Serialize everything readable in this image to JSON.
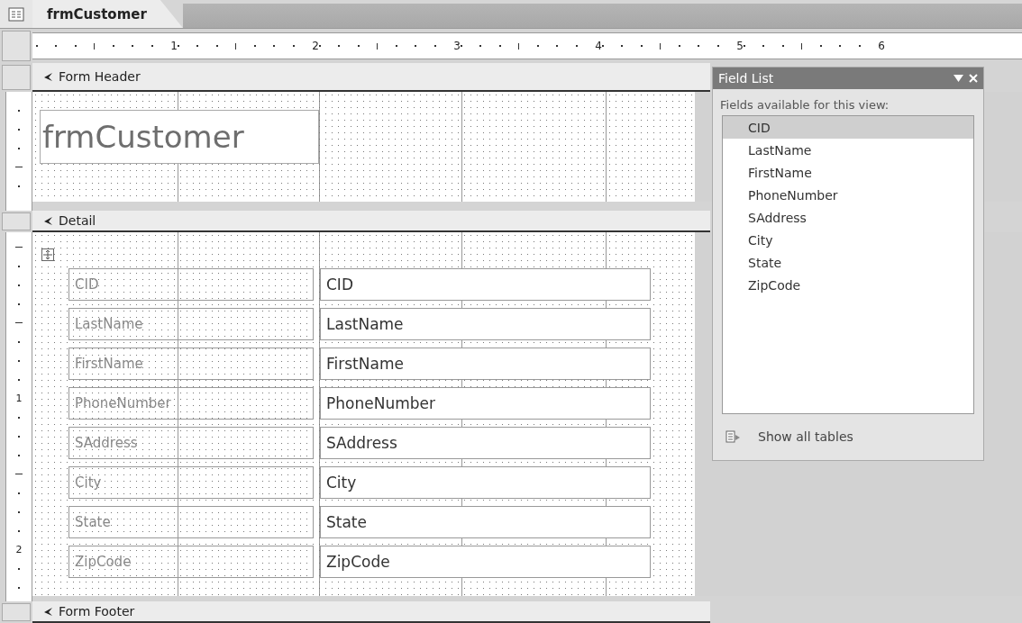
{
  "tab": {
    "title": "frmCustomer",
    "selected": true
  },
  "ruler": {
    "horizontal": [
      "1",
      "2",
      "3",
      "4",
      "5",
      "6"
    ],
    "vertical": [
      "1",
      "2"
    ]
  },
  "form_header": {
    "label": "Form Header",
    "title": "frmCustomer"
  },
  "detail": {
    "label": "Detail",
    "rows": [
      {
        "label": "CID",
        "field": "CID"
      },
      {
        "label": "LastName",
        "field": "LastName"
      },
      {
        "label": "FirstName",
        "field": "FirstName"
      },
      {
        "label": "PhoneNumber",
        "field": "PhoneNumber"
      },
      {
        "label": "SAddress",
        "field": "SAddress"
      },
      {
        "label": "City",
        "field": "City"
      },
      {
        "label": "State",
        "field": "State"
      },
      {
        "label": "ZipCode",
        "field": "ZipCode"
      }
    ]
  },
  "form_footer": {
    "label": "Form Footer"
  },
  "field_list": {
    "title": "Field List",
    "subtitle": "Fields available for this view:",
    "fields": [
      {
        "name": "CID",
        "selected": true
      },
      {
        "name": "LastName",
        "selected": false
      },
      {
        "name": "FirstName",
        "selected": false
      },
      {
        "name": "PhoneNumber",
        "selected": false
      },
      {
        "name": "SAddress",
        "selected": false
      },
      {
        "name": "City",
        "selected": false
      },
      {
        "name": "State",
        "selected": false
      },
      {
        "name": "ZipCode",
        "selected": false
      }
    ],
    "link": "Show all tables"
  }
}
